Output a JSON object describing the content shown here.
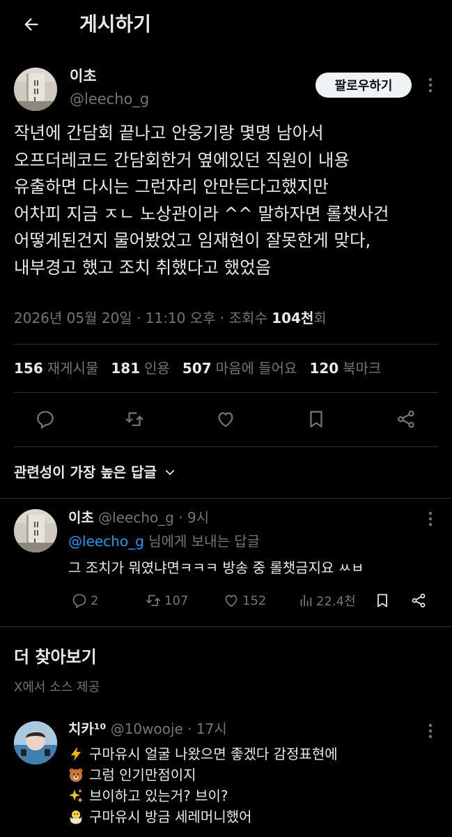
{
  "header": {
    "title": "게시하기",
    "back_icon": "arrow-left-icon"
  },
  "post": {
    "author_name": "이초",
    "author_handle": "@leecho_g",
    "follow_label": "팔로우하기",
    "text_lines": [
      "작년에 간담회 끝나고 안웅기랑 몇명 남아서",
      "오프더레코드 간담회한거 옆에있던 직원이 내용",
      "유출하면 다시는 그런자리 안만든다고했지만",
      "어차피 지금 ㅈㄴ 노상관이라 ^^ 말하자면 롤챗사건",
      "어떻게된건지 물어봤었고 임재현이 잘못한게 맞다,",
      "내부경고 했고 조치 취했다고 했었음"
    ],
    "timestamp": "2026년 05월 20일 · 11:10 오후 · 조회수 ",
    "views": "104천",
    "views_suffix": "회",
    "stats": {
      "reposts_count": "156",
      "reposts_label": "재게시물",
      "quotes_count": "181",
      "quotes_label": "인용",
      "likes_count": "507",
      "likes_label": "마음에 들어요",
      "bookmarks_count": "120",
      "bookmarks_label": "북마크"
    }
  },
  "sort": {
    "label": "관련성이 가장 높은 답글"
  },
  "reply": {
    "author_name": "이초",
    "author_handle": "@leecho_g",
    "time": " · 9시",
    "reply_to_handle": "@leecho_g",
    "reply_to_suffix": " 님에게 보내는 답글",
    "text": "그 조치가 뭐였냐면ㅋㅋㅋ 방송 중 롤챗금지요 ㅆㅂ",
    "replies": "2",
    "reposts": "107",
    "likes": "152",
    "views": "22.4천"
  },
  "explore": {
    "title": "더 찾아보기",
    "subtitle": "X에서 소스 제공"
  },
  "recommended": {
    "author_name": "치카¹⁰",
    "author_handle": "@10wooje",
    "time": " · 17시",
    "lines": [
      {
        "emoji": "lightning-emoji",
        "text": "구마유시 얼굴 나왔으면 좋겠다 감정표현에"
      },
      {
        "emoji": "bear-emoji",
        "text": "그럼 인기만점이지"
      },
      {
        "emoji": "sparkles-emoji",
        "text": "브이하고 있는거? 브이?"
      },
      {
        "emoji": "hatching-chick-emoji",
        "text": "구마유시 방금 세레머니했어"
      }
    ]
  },
  "colors": {
    "background": "#000000",
    "text": "#e7e9ea",
    "muted": "#71767b",
    "link": "#1d9bf0",
    "divider": "#2f3336",
    "follow_bg": "#eff3f4"
  }
}
